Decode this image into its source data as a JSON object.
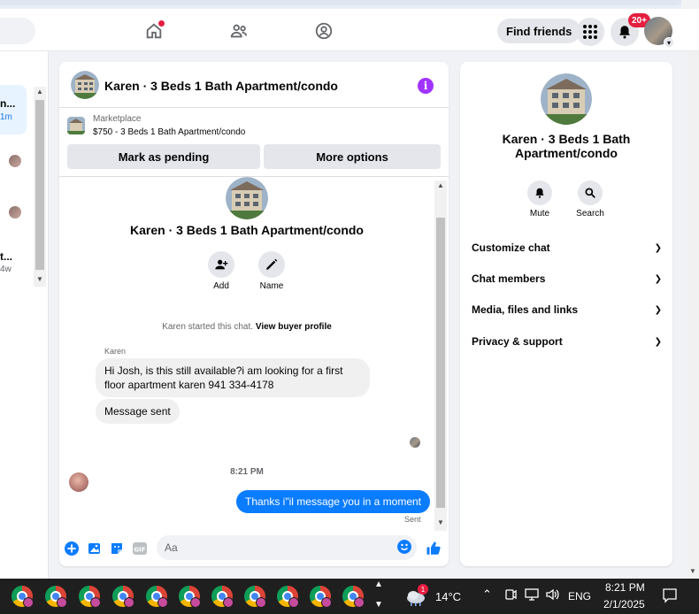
{
  "header": {
    "find_friends": "Find friends",
    "notification_count": "20+"
  },
  "left_list": {
    "item1_name": "n...",
    "item1_time": "1m",
    "item4_name": "t...",
    "item4_time": "4w"
  },
  "chat": {
    "title": "Karen · 3 Beds 1 Bath Apartment/condo",
    "marketplace_label": "Marketplace",
    "listing": "$750 - 3 Beds 1 Bath Apartment/condo",
    "mark_pending": "Mark as pending",
    "more_options": "More options",
    "thread_name": "Karen · 3 Beds 1 Bath Apartment/condo",
    "add_label": "Add",
    "name_label": "Name",
    "system_message": "Karen started this chat.",
    "view_buyer_profile": "View buyer profile",
    "sender_name": "Karen",
    "message1": "Hi Josh, is this still available?i am looking for a first floor apartment karen 941 334-4178",
    "message2": "Message sent",
    "timestamp": "8:21 PM",
    "outgoing_message": "Thanks i\"il message you in a moment",
    "sent_status": "Sent",
    "composer_placeholder": "Aa"
  },
  "right_panel": {
    "name": "Karen · 3 Beds 1 Bath Apartment/condo",
    "mute_label": "Mute",
    "search_label": "Search",
    "menu": [
      "Customize chat",
      "Chat members",
      "Media, files and links",
      "Privacy & support"
    ]
  },
  "taskbar": {
    "temperature": "14°C",
    "weather_badge": "1",
    "language": "ENG",
    "time": "8:21 PM",
    "date": "2/1/2025"
  },
  "colors": {
    "messenger_blue": "#0a7cff",
    "info_purple": "#a033ff",
    "notification_red": "#e41e3f"
  }
}
